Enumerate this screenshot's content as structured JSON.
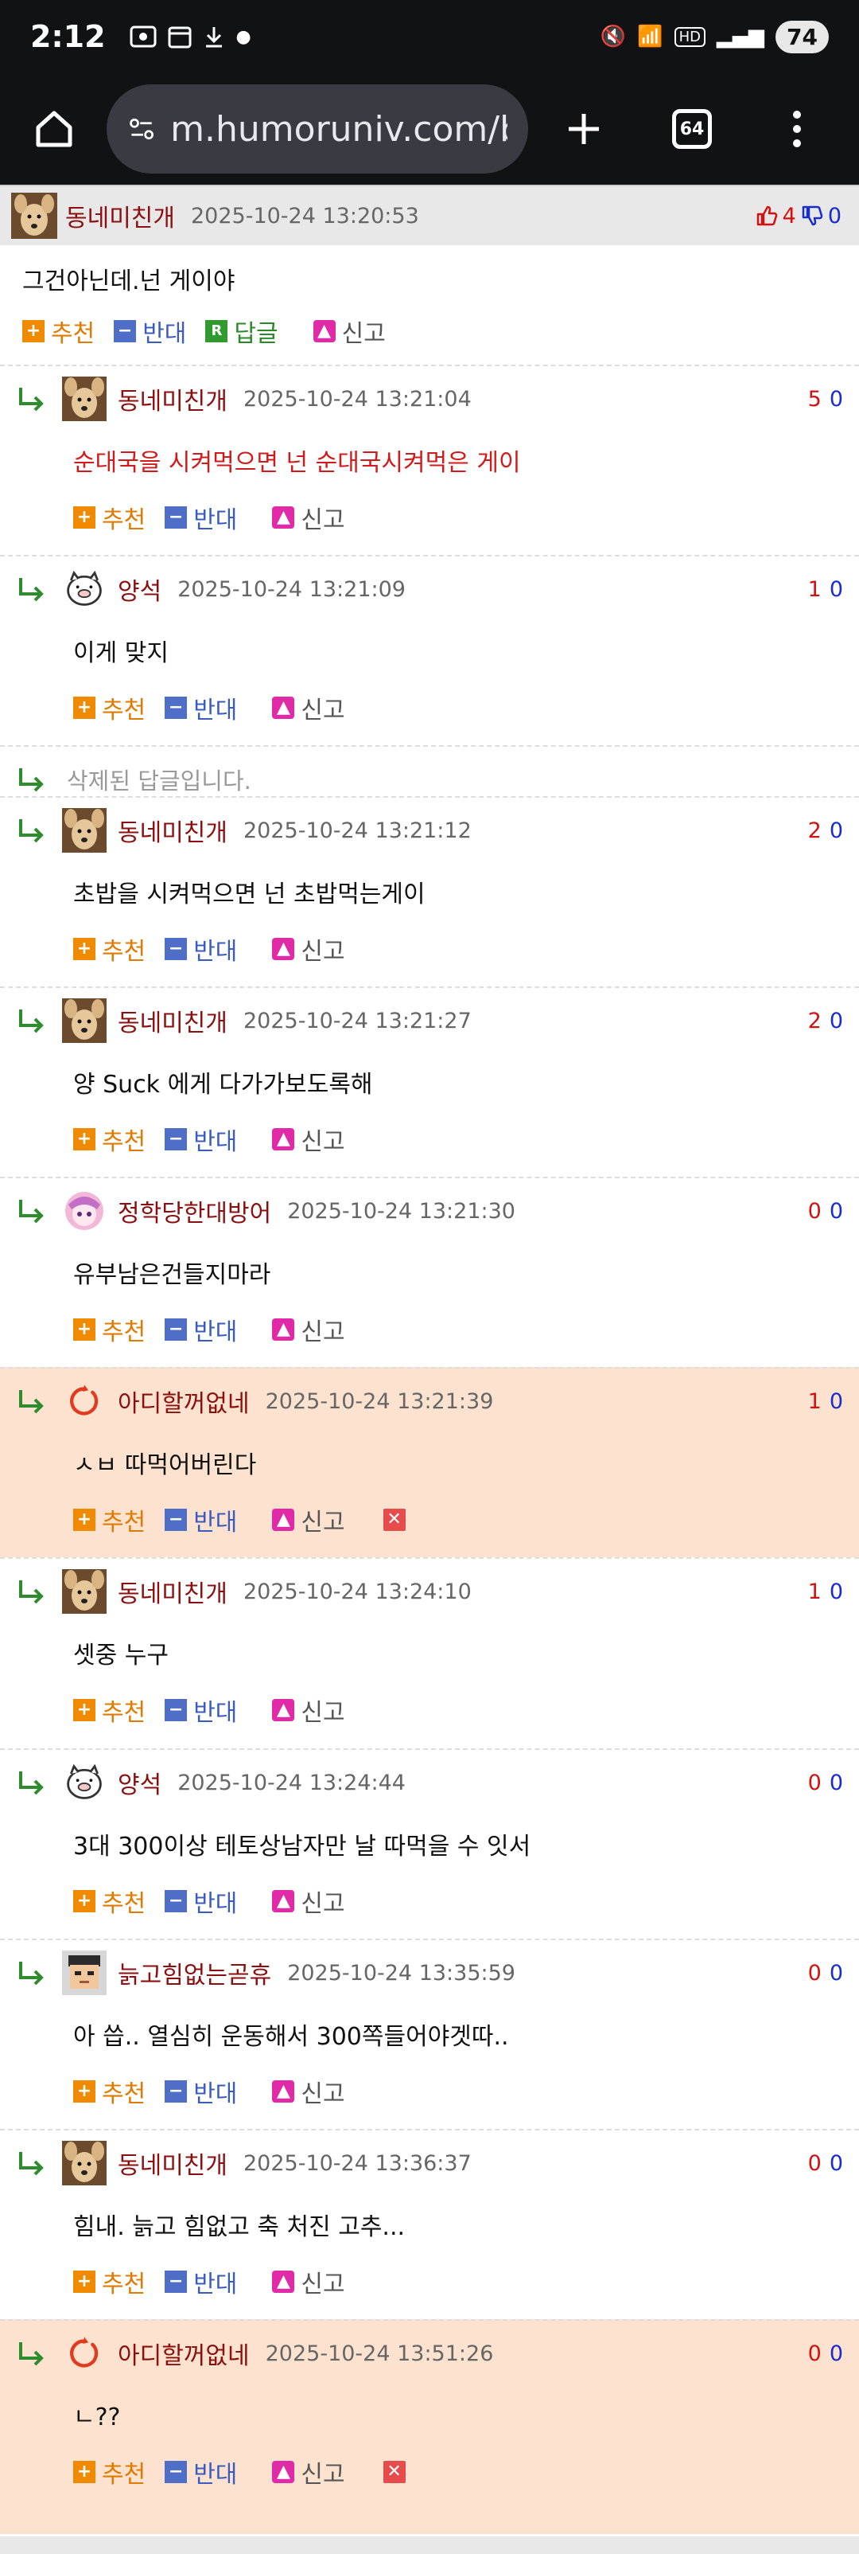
{
  "status": {
    "time": "2:12",
    "battery": "74"
  },
  "browser": {
    "url": "m.humoruniv.com/bo",
    "tab_count": "64"
  },
  "top_comment": {
    "nick": "동네미친개",
    "time": "2025-10-24 13:20:53",
    "up": "4",
    "down": "0",
    "text": "그건아닌데.넌 게이야",
    "actions": {
      "recommend": "추천",
      "oppose": "반대",
      "reply": "답글",
      "report": "신고"
    }
  },
  "replies": [
    {
      "nick": "동네미친개",
      "time": "2025-10-24 13:21:04",
      "up": "5",
      "down": "0",
      "text": "순대국을 시켜먹으면 넌 순대국시켜먹은 게이",
      "avatar": "dog"
    },
    {
      "nick": "양석",
      "time": "2025-10-24 13:21:09",
      "up": "1",
      "down": "0",
      "text": "이게 맞지",
      "avatar": "pig"
    },
    {
      "deleted": "삭제된 답글입니다."
    },
    {
      "nick": "동네미친개",
      "time": "2025-10-24 13:21:12",
      "up": "2",
      "down": "0",
      "text": "초밥을 시켜먹으면 넌 초밥먹는게이",
      "avatar": "dog"
    },
    {
      "nick": "동네미친개",
      "time": "2025-10-24 13:21:27",
      "up": "2",
      "down": "0",
      "text": "양 Suck 에게 다가가보도록해",
      "avatar": "dog"
    },
    {
      "nick": "정학당한대방어",
      "time": "2025-10-24 13:21:30",
      "up": "0",
      "down": "0",
      "text": "유부남은건들지마라",
      "avatar": "anime"
    },
    {
      "nick": "아디할꺼없네",
      "time": "2025-10-24 13:21:39",
      "up": "1",
      "down": "0",
      "text": "ㅅㅂ 따먹어버린다",
      "avatar": "ring"
    },
    {
      "nick": "동네미친개",
      "time": "2025-10-24 13:24:10",
      "up": "1",
      "down": "0",
      "text": "셋중 누구",
      "avatar": "dog"
    },
    {
      "nick": "양석",
      "time": "2025-10-24 13:24:44",
      "up": "0",
      "down": "0",
      "text": "3대 300이상 테토상남자만 날 따먹을 수 잇서",
      "avatar": "pig"
    },
    {
      "nick": "늙고힘없는곧휴",
      "time": "2025-10-24 13:35:59",
      "up": "0",
      "down": "0",
      "text": "아 씁.. 열심히 운동해서 300쪽들어야겟따..",
      "avatar": "pixel"
    },
    {
      "nick": "동네미친개",
      "time": "2025-10-24 13:36:37",
      "up": "0",
      "down": "0",
      "text": "힘내. 늙고 힘없고 축 처진 고추...",
      "avatar": "dog"
    },
    {
      "nick": "아디할꺼없네",
      "time": "2025-10-24 13:51:26",
      "up": "0",
      "down": "0",
      "text": "ㄴ??",
      "avatar": "ring"
    }
  ],
  "colors": {
    "nick": "#8b0f0f",
    "up": "#d21111",
    "down": "#1a2dcc",
    "highlight": "#fde3cf"
  }
}
